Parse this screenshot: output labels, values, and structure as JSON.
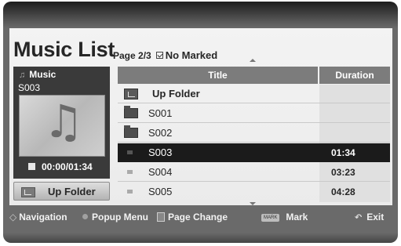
{
  "header": {
    "title": "Music List",
    "page_info": "Page 2/3",
    "marked_label": "No Marked"
  },
  "info_panel": {
    "category": "Music",
    "file_name": "S003",
    "time": "00:00/01:34",
    "icons": {
      "category": "music-note-icon",
      "thumbnail": "music-note-icon",
      "time": "stop-icon"
    }
  },
  "up_folder_button": {
    "label": "Up Folder",
    "icon": "up-folder-icon"
  },
  "table": {
    "columns": [
      "Title",
      "Duration"
    ],
    "rows": [
      {
        "type": "up-folder",
        "title": "Up Folder",
        "duration": ""
      },
      {
        "type": "folder",
        "title": "S001",
        "duration": ""
      },
      {
        "type": "folder",
        "title": "S002",
        "duration": ""
      },
      {
        "type": "file",
        "title": "S003",
        "duration": "01:34",
        "selected": true
      },
      {
        "type": "file",
        "title": "S004",
        "duration": "03:23"
      },
      {
        "type": "file",
        "title": "S005",
        "duration": "04:28"
      }
    ]
  },
  "footer": {
    "navigation": "Navigation",
    "popup_menu": "Popup Menu",
    "page_change": "Page Change",
    "mark_badge": "MARK",
    "mark": "Mark",
    "exit": "Exit"
  },
  "colors": {
    "panel_bg": "#efefef",
    "selected_row": "#1b1b1b",
    "header_bg": "#7c7c7c",
    "info_panel": "#3a3a3a"
  }
}
